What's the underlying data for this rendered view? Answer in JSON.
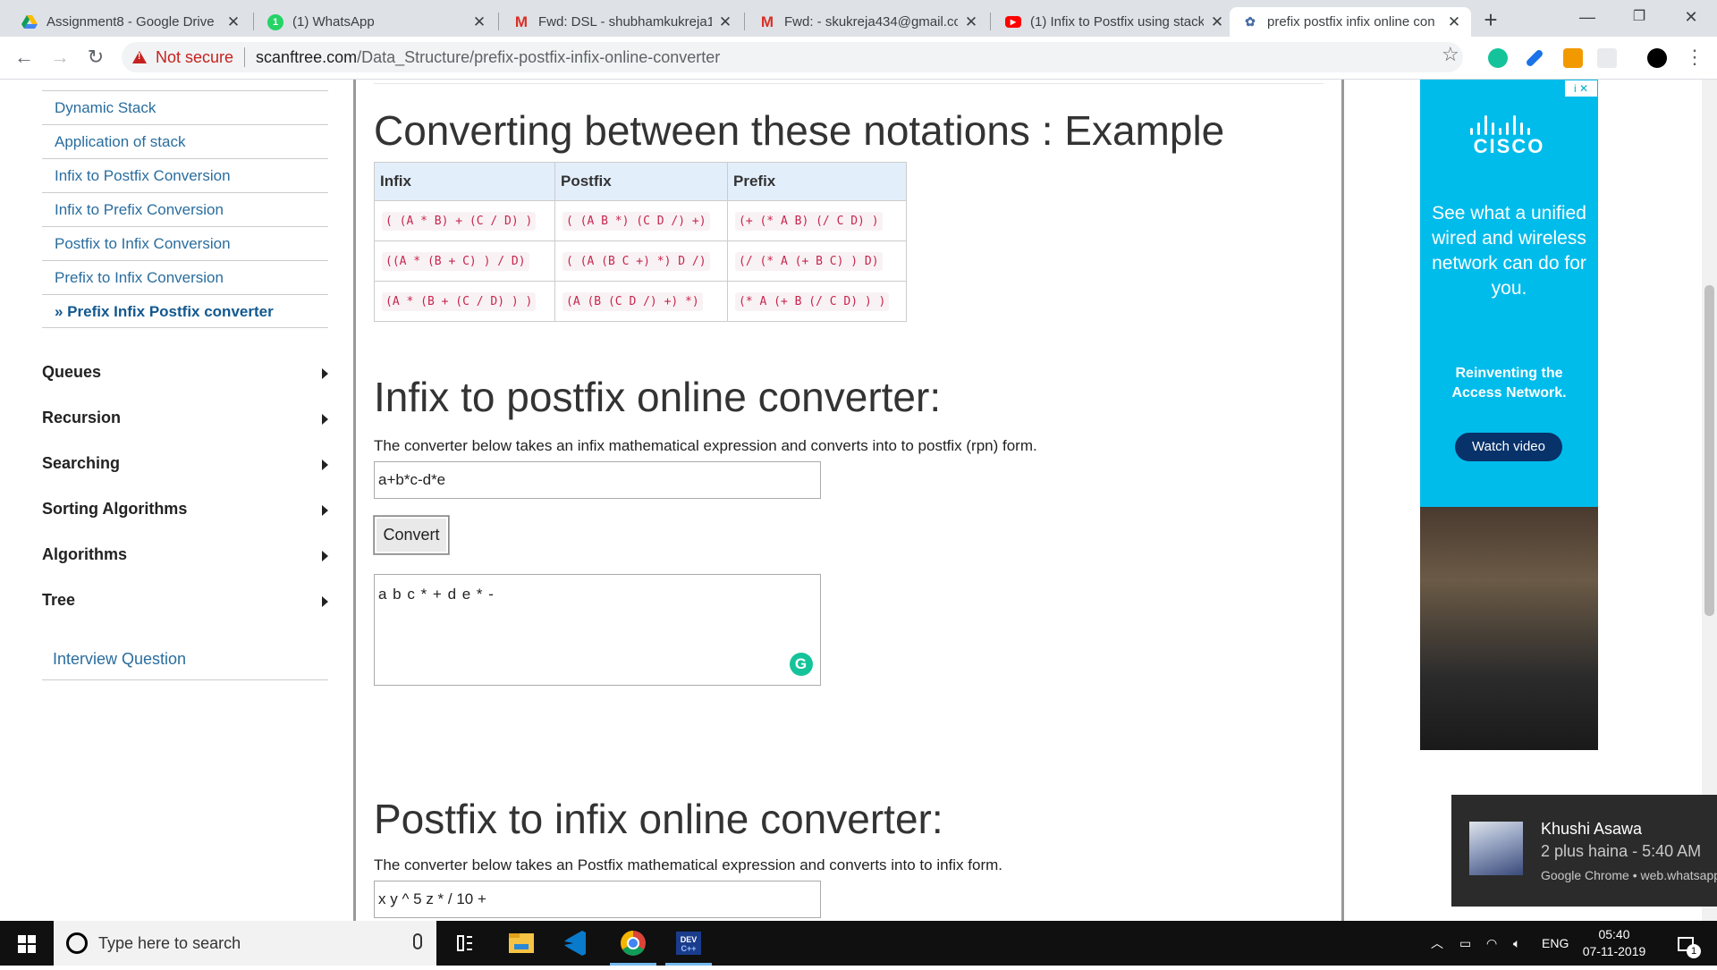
{
  "tabs": [
    {
      "title": "Assignment8 - Google Drive",
      "icon": "google-drive-icon"
    },
    {
      "title": "(1) WhatsApp",
      "icon": "whatsapp-icon"
    },
    {
      "title": "Fwd: DSL - shubhamkukreja1",
      "icon": "gmail-icon"
    },
    {
      "title": "Fwd: - skukreja434@gmail.co",
      "icon": "gmail-icon"
    },
    {
      "title": "(1) Infix to Postfix using stack",
      "icon": "youtube-icon"
    },
    {
      "title": "prefix postfix infix online con",
      "icon": "site-icon"
    }
  ],
  "address": {
    "security_label": "Not secure",
    "host": "scanftree.com",
    "path": "/Data_Structure/prefix-postfix-infix-online-converter"
  },
  "sidebar": {
    "sub_items": [
      "Dynamic Stack",
      "Application of stack",
      "Infix to Postfix Conversion",
      "Infix to Prefix Conversion",
      "Postfix to Infix Conversion",
      "Prefix to Infix Conversion",
      "» Prefix Infix Postfix converter"
    ],
    "main_items": [
      "Queues",
      "Recursion",
      "Searching",
      "Sorting Algorithms",
      "Algorithms",
      "Tree"
    ],
    "interview": "Interview Question"
  },
  "content": {
    "example_heading": "Converting between these notations : Example",
    "table": {
      "headers": [
        "Infix",
        "Postfix",
        "Prefix"
      ],
      "rows": [
        [
          "( (A * B) + (C / D) )",
          "( (A B *) (C D /) +)",
          "(+ (* A B) (/ C D) )"
        ],
        [
          "((A * (B + C) ) / D)",
          "( (A (B C +) *) D /)",
          "(/ (* A (+ B C) ) D)"
        ],
        [
          "(A * (B + (C / D) ) )",
          "(A (B (C D /) +) *)",
          "(* A (+ B (/ C D) ) )"
        ]
      ]
    },
    "infix_heading": "Infix to postfix online converter:",
    "infix_desc": "The converter below takes an infix mathematical expression and converts into to postfix (rpn) form.",
    "infix_input": "a+b*c-d*e",
    "convert_label": "Convert",
    "infix_output": "a b c * + d e * -",
    "postfix_heading": "Postfix to infix online converter:",
    "postfix_desc": "The converter below takes an Postfix mathematical expression and converts into to infix form.",
    "postfix_input": "x y ^ 5 z * / 10 +"
  },
  "ad": {
    "choices": "i ✕",
    "brand": "CISCO",
    "tagline": "See what a unified wired and wireless network can do for you.",
    "headline": "Reinventing the Access Network.",
    "cta": "Watch video"
  },
  "notification": {
    "sender": "Khushi Asawa",
    "message": "2 plus haina - 5:40 AM",
    "source": "Google Chrome • web.whatsapp.com"
  },
  "taskbar": {
    "search_placeholder": "Type here to search",
    "language": "ENG",
    "time": "05:40",
    "date": "07-11-2019",
    "notification_count": "1"
  },
  "colors": {
    "link": "#2a6d9e",
    "code_text": "#c7254e",
    "table_header_bg": "#e3eefb",
    "ad_bg": "#00bceb",
    "grammarly": "#15c39a"
  }
}
